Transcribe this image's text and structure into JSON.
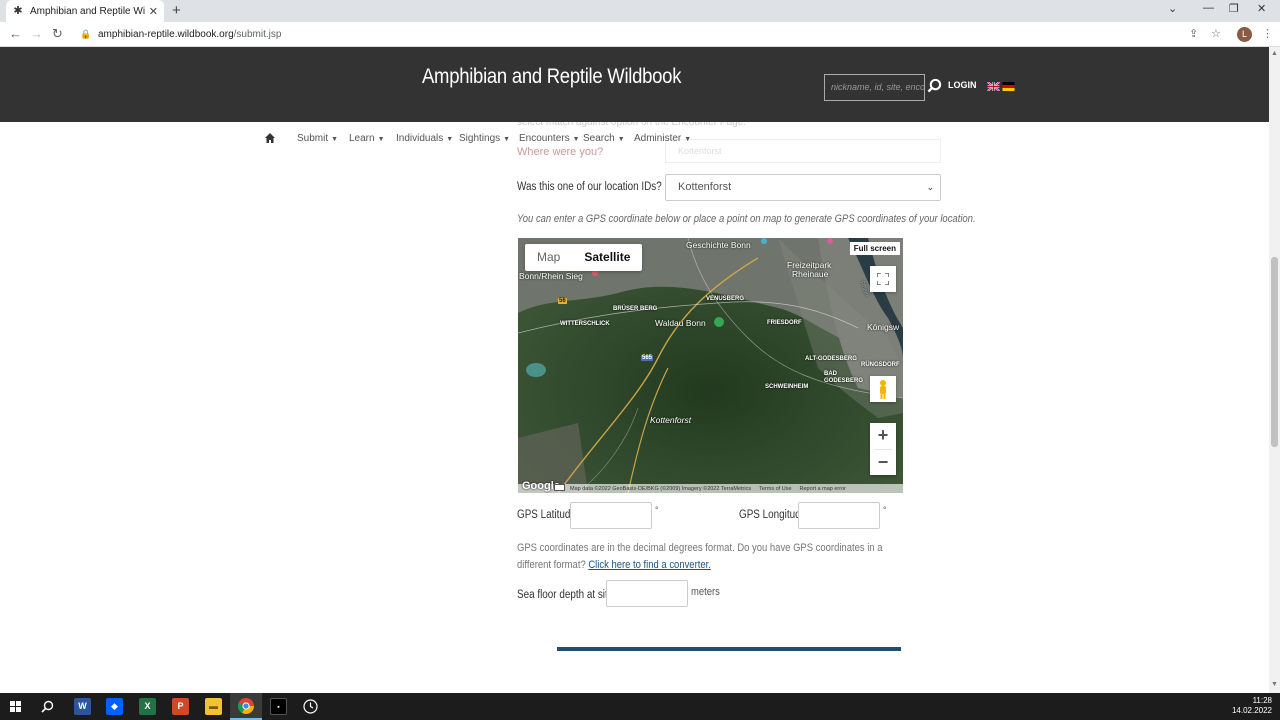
{
  "browser": {
    "tab_title": "Amphibian and Reptile Wildbook",
    "url_host": "amphibian-reptile.wildbook.org",
    "url_path": "/submit.jsp",
    "profile_initial": "L"
  },
  "header": {
    "title": "Amphibian and Reptile Wildbook",
    "search_placeholder": "nickname, id, site, encou",
    "login_label": "LOGIN"
  },
  "nav": {
    "items": [
      {
        "label": "Submit"
      },
      {
        "label": "Learn"
      },
      {
        "label": "Individuals"
      },
      {
        "label": "Sightings"
      },
      {
        "label": "Encounters"
      },
      {
        "label": "Search"
      },
      {
        "label": "Administer"
      }
    ]
  },
  "form": {
    "ghost_text_top": "select match against option on the Encounter Page.",
    "where_label": "Where were you?",
    "where_value": "Kottenforst",
    "location_id_label": "Was this one of our location IDs?",
    "location_id_value": "Kottenforst",
    "gps_hint": "You can enter a GPS coordinate below or place a point on map to generate GPS coordinates of your location.",
    "gps_latitude_label": "GPS Latitude",
    "gps_longitude_label": "GPS Longitude",
    "degree_symbol": "°",
    "gps_note": "GPS coordinates are in the decimal degrees format. Do you have GPS coordinates in a different format?",
    "converter_link": "Click here to find a converter.",
    "sea_floor_label": "Sea floor depth at site",
    "meters_label": "meters"
  },
  "map": {
    "type_map": "Map",
    "type_satellite": "Satellite",
    "fullscreen_label": "Full screen",
    "labels": {
      "geschichte": "Geschichte Bonn",
      "freizeitpark": "Freizeitpark",
      "rheinaue": "Rheinaue",
      "bonn_rhein_sieg": "Bonn/Rhein Sieg",
      "venusberg": "VENUSBERG",
      "bruser_berg": "BRÜSER BERG",
      "witterschlick": "WITTERSCHLICK",
      "waldau": "Waldau Bonn",
      "friesdorf": "FRIESDORF",
      "konigsw": "Königsw",
      "alt_godesberg": "ALT-GODESBERG",
      "rungsdorf": "RÜNGSDORF",
      "bad_godesberg": "BAD GODESBERG",
      "schweinheim": "SCHWEINHEIM",
      "kottenforst": "Kottenforst",
      "road_565": "565",
      "road_56": "56",
      "rhein_label": "Rhein"
    },
    "google": "Google",
    "attribution": "Map data ©2022 GeoBasis-DE/BKG (©2009) Imagery ©2022 TerraMetrics",
    "terms": "Terms of Use",
    "report": "Report a map error"
  },
  "taskbar": {
    "time": "11:28",
    "date": "14.02.2022"
  }
}
